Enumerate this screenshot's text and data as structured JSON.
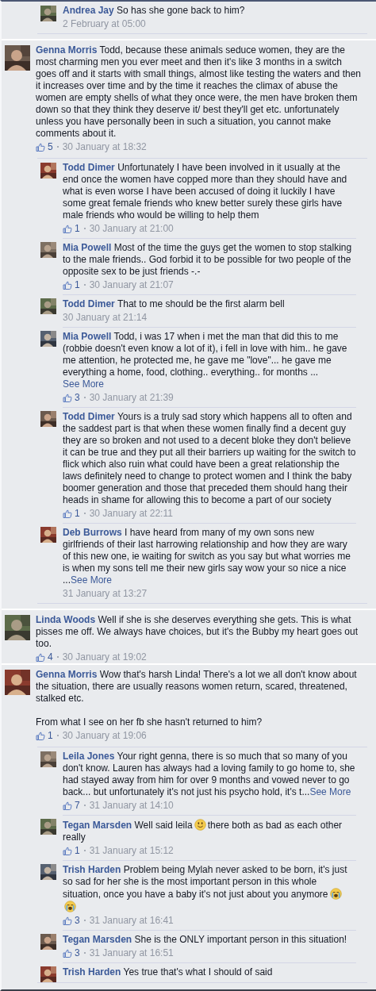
{
  "threads": [
    {
      "replies": [
        {
          "name": "Andrea Jay",
          "body": [
            {
              "kind": "text",
              "text": "So has she gone back to him?"
            }
          ],
          "time": "2 February at 05:00"
        }
      ]
    },
    {
      "comment": {
        "name": "Genna Morris",
        "body": [
          {
            "kind": "text",
            "text": "Todd, because these animals seduce women, they are the most charming men you ever meet and then it's like 3 months in a switch goes off and it starts with small things, almost like testing the waters and then it increases over time and by the time it reaches the climax of abuse the women are empty shells of what they once were, the men have broken them down so that they think they deserve it/ best they'll get etc. unfortunately unless you have personally been in such a situation, you cannot make comments about it."
          }
        ],
        "likes": "5",
        "time": "30 January at 18:32"
      },
      "replies": [
        {
          "name": "Todd Dimer",
          "body": [
            {
              "kind": "text",
              "text": "Unfortunately I have been involved in it usually at the end once the women have copped more than they should have and what is even worse I have been accused of doing it luckily I have some great female friends who knew better surely these girls have male friends who would be willing to help them"
            }
          ],
          "likes": "1",
          "time": "30 January at 21:00"
        },
        {
          "name": "Mia Powell",
          "body": [
            {
              "kind": "text",
              "text": "Most of the time the guys get the women to stop stalking to the male friends.. God forbid it to be possible for two people of the opposite sex to be just friends -.-"
            }
          ],
          "likes": "1",
          "time": "30 January at 21:07"
        },
        {
          "name": "Todd Dimer",
          "body": [
            {
              "kind": "text",
              "text": "That to me should be the first alarm bell"
            }
          ],
          "time": "30 January at 21:14"
        },
        {
          "name": "Mia Powell",
          "body": [
            {
              "kind": "text",
              "text": "Todd, i was 17 when i met the man that did this to me (robbie doesn't even know a lot of it), i fell in love with him.. he gave me attention, he protected me, he gave me \"love\"... he gave me everything a home, food, clothing.. everything.. for months ..."
            },
            {
              "kind": "break"
            },
            {
              "kind": "link",
              "text": "See More"
            }
          ],
          "likes": "3",
          "time": "30 January at 21:39"
        },
        {
          "name": "Todd Dimer",
          "body": [
            {
              "kind": "text",
              "text": "Yours is a truly sad story which happens all to often and the saddest part is that when these women finally find a decent guy they are so broken and not used to a decent bloke they don't believe it can be true and they put all their barriers up waiting for the switch to flick which also ruin what could have been a great relationship the laws definitely need to change to protect women and I think the baby boomer generation and those that preceded them should hang their heads in shame for allowing this to become a part of our society"
            }
          ],
          "likes": "1",
          "time": "30 January at 22:11"
        },
        {
          "name": "Deb Burrows",
          "body": [
            {
              "kind": "text",
              "text": "I have heard from many of my own sons new girlfriends of their last harrowing relationship and how they are wary of this new one, ie waiting for switch as you say but what worries me is when my sons tell me their new girls say wow your so nice a nice ..."
            },
            {
              "kind": "link",
              "text": "See More"
            }
          ],
          "time": "31 January at 13:27"
        }
      ]
    },
    {
      "comment": {
        "name": "Linda Woods",
        "body": [
          {
            "kind": "text",
            "text": "Well if she is she deserves everything she gets. This is what pisses me off. We always have choices, but it's the Bubby my heart goes out too."
          }
        ],
        "likes": "4",
        "time": "30 January at 19:02"
      }
    },
    {
      "comment": {
        "name": "Genna Morris",
        "body": [
          {
            "kind": "text",
            "text": "Wow that's harsh Linda! There's a lot we all don't know about the situation, there are usually reasons women return, scared, threatened, stalked etc.\n\nFrom what I see on her fb she hasn't returned to him?"
          }
        ],
        "likes": "1",
        "time": "30 January at 19:06"
      },
      "replies": [
        {
          "name": "Leila Jones",
          "body": [
            {
              "kind": "text",
              "text": "Your right genna, there is so much that so many of you don't know. Lauren has always had a loving family to go home to, she had stayed away from him for over 9 months and vowed never to go back... but unfortunately it's not just his psycho hold, it's t..."
            },
            {
              "kind": "link",
              "text": "See More"
            }
          ],
          "likes": "7",
          "time": "31 January at 14:10"
        },
        {
          "name": "Tegan Marsden",
          "body": [
            {
              "kind": "text",
              "text": "Well said leila"
            },
            {
              "kind": "smile_emoji"
            },
            {
              "kind": "text",
              "text": "there both as bad as each other really"
            }
          ],
          "likes": "1",
          "time": "31 January at 15:12"
        },
        {
          "name": "Trish Harden",
          "body": [
            {
              "kind": "text",
              "text": "Problem being Mylah never asked to be born, it's just so sad for her she is the most important person in this whole situation, once you have a baby it's not just about you anymore"
            },
            {
              "kind": "crying_emoji"
            },
            {
              "kind": "crying_emoji"
            }
          ],
          "likes": "3",
          "time": "31 January at 16:41"
        },
        {
          "name": "Tegan Marsden",
          "body": [
            {
              "kind": "text",
              "text": "She is the ONLY important person in this situation!"
            }
          ],
          "likes": "3",
          "time": "31 January at 16:51"
        },
        {
          "name": "Trish Harden",
          "body": [
            {
              "kind": "text",
              "text": "Yes true that's what I should of said"
            }
          ]
        }
      ]
    }
  ]
}
